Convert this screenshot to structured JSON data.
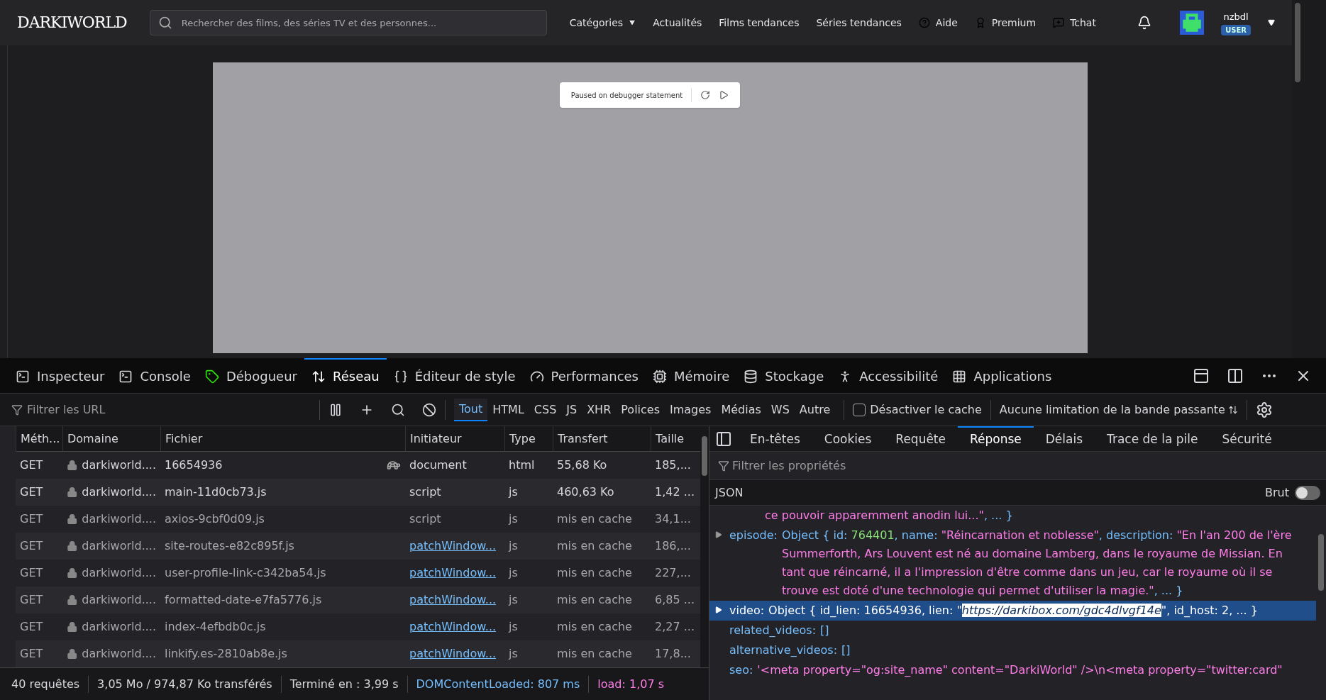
{
  "site": {
    "logo": "DARKIWORLD",
    "search": {
      "placeholder": "Rechercher des films, des séries TV et des personnes..."
    },
    "nav": [
      {
        "label": "Catégories",
        "kind": "dropdown"
      },
      {
        "label": "Actualités",
        "kind": "link"
      },
      {
        "label": "Films tendances",
        "kind": "link"
      },
      {
        "label": "Séries tendances",
        "kind": "link"
      },
      {
        "label": "Aide",
        "kind": "help"
      },
      {
        "label": "Premium",
        "kind": "premium"
      },
      {
        "label": "Tchat",
        "kind": "chat"
      }
    ],
    "user": {
      "name": "nzbdl",
      "badge": "USER"
    },
    "debugger_banner": "Paused on debugger statement"
  },
  "devtools": {
    "tabs": [
      {
        "label": "Inspecteur",
        "selected": false
      },
      {
        "label": "Console",
        "selected": false
      },
      {
        "label": "Débogueur",
        "selected": false
      },
      {
        "label": "Réseau",
        "selected": true
      },
      {
        "label": "Éditeur de style",
        "selected": false
      },
      {
        "label": "Performances",
        "selected": false
      },
      {
        "label": "Mémoire",
        "selected": false
      },
      {
        "label": "Stockage",
        "selected": false
      },
      {
        "label": "Accessibilité",
        "selected": false
      },
      {
        "label": "Applications",
        "selected": false
      }
    ],
    "url_filter": {
      "placeholder": "Filtrer les URL"
    },
    "type_filters": [
      {
        "label": "Tout",
        "selected": true
      },
      {
        "label": "HTML",
        "selected": false
      },
      {
        "label": "CSS",
        "selected": false
      },
      {
        "label": "JS",
        "selected": false
      },
      {
        "label": "XHR",
        "selected": false
      },
      {
        "label": "Polices",
        "selected": false
      },
      {
        "label": "Images",
        "selected": false
      },
      {
        "label": "Médias",
        "selected": false
      },
      {
        "label": "WS",
        "selected": false
      },
      {
        "label": "Autre",
        "selected": false
      }
    ],
    "disable_cache": {
      "label": "Désactiver le cache",
      "checked": false
    },
    "throttling": "Aucune limitation de la bande passante",
    "table": {
      "columns": [
        "Méth...",
        "Domaine",
        "Fichier",
        "Initiateur",
        "Type",
        "Transfert",
        "Taille"
      ],
      "rows": [
        {
          "method": "GET",
          "domain": "darkiworld....",
          "file": "16654936",
          "slow": true,
          "initiator": "document",
          "initiator_link": false,
          "type": "html",
          "transfer": "55,68 Ko",
          "size": "185,...",
          "cached": false
        },
        {
          "method": "GET",
          "domain": "darkiworld....",
          "file": "main-11d0cb73.js",
          "slow": false,
          "initiator": "script",
          "initiator_link": false,
          "type": "js",
          "transfer": "460,63 Ko",
          "size": "1,42 ...",
          "cached": false
        },
        {
          "method": "GET",
          "domain": "darkiworld....",
          "file": "axios-9cbf0d09.js",
          "slow": false,
          "initiator": "script",
          "initiator_link": false,
          "type": "js",
          "transfer": "mis en cache",
          "size": "34,1...",
          "cached": true
        },
        {
          "method": "GET",
          "domain": "darkiworld....",
          "file": "site-routes-e82c895f.js",
          "slow": false,
          "initiator": "patchWindow...",
          "initiator_link": true,
          "type": "js",
          "transfer": "mis en cache",
          "size": "186,...",
          "cached": true
        },
        {
          "method": "GET",
          "domain": "darkiworld....",
          "file": "user-profile-link-c342ba54.js",
          "slow": false,
          "initiator": "patchWindow...",
          "initiator_link": true,
          "type": "js",
          "transfer": "mis en cache",
          "size": "227,...",
          "cached": true
        },
        {
          "method": "GET",
          "domain": "darkiworld....",
          "file": "formatted-date-e7fa5776.js",
          "slow": false,
          "initiator": "patchWindow...",
          "initiator_link": true,
          "type": "js",
          "transfer": "mis en cache",
          "size": "6,85 ...",
          "cached": true
        },
        {
          "method": "GET",
          "domain": "darkiworld....",
          "file": "index-4efbdb0c.js",
          "slow": false,
          "initiator": "patchWindow...",
          "initiator_link": true,
          "type": "js",
          "transfer": "mis en cache",
          "size": "2,27 ...",
          "cached": true
        },
        {
          "method": "GET",
          "domain": "darkiworld....",
          "file": "linkify.es-2810ab8e.js",
          "slow": false,
          "initiator": "patchWindow...",
          "initiator_link": true,
          "type": "js",
          "transfer": "mis en cache",
          "size": "17,8...",
          "cached": true
        }
      ]
    },
    "status_bar": [
      {
        "text": "40 requêtes",
        "color": "#d7d7db"
      },
      {
        "text": "3,05 Mo / 974,87 Ko transférés",
        "color": "#d7d7db"
      },
      {
        "text": "Terminé en : 3,99 s",
        "color": "#d7d7db"
      },
      {
        "text": "DOMContentLoaded: 807 ms",
        "color": "#75bfff"
      },
      {
        "text": "load: 1,07 s",
        "color": "#ff7de9"
      }
    ],
    "detail_tabs": [
      {
        "label": "En-têtes",
        "selected": false
      },
      {
        "label": "Cookies",
        "selected": false
      },
      {
        "label": "Requête",
        "selected": false
      },
      {
        "label": "Réponse",
        "selected": true
      },
      {
        "label": "Délais",
        "selected": false
      },
      {
        "label": "Trace de la pile",
        "selected": false
      },
      {
        "label": "Sécurité",
        "selected": false
      }
    ],
    "property_filter": {
      "placeholder": "Filtrer les propriétés"
    },
    "response": {
      "label": "JSON",
      "raw": {
        "label": "Brut",
        "on": false
      },
      "lines": [
        {
          "expandable": false,
          "selected": false,
          "tokens": [
            {
              "kind": "string",
              "text": "ce pouvoir apparemment anodin lui...\""
            },
            {
              "kind": "plain",
              "text": ", ... }"
            }
          ]
        },
        {
          "key": "episode:",
          "expandable": true,
          "selected": false,
          "tokens": [
            {
              "kind": "plain",
              "text": "Object { id: "
            },
            {
              "kind": "number",
              "text": "764401"
            },
            {
              "kind": "plain",
              "text": ", name: "
            },
            {
              "kind": "string",
              "text": "\"Réincarnation et noblesse\""
            },
            {
              "kind": "plain",
              "text": ", description: "
            },
            {
              "kind": "string",
              "text": "\"En l'an 200 de l'ère Summerforth, Ars Louvent est né au domaine Lamberg, dans le royaume de Missian. En tant que réincarné, il a l'impression d'être comme dans un jeu, car le royaume où il se trouve est doté d'une technologie qui permet d'utiliser la magie.\""
            },
            {
              "kind": "plain",
              "text": ", ... }"
            }
          ]
        },
        {
          "key": "video:",
          "expandable": true,
          "selected": true,
          "tokens": [
            {
              "kind": "plain",
              "text": "Object { id_lien: 16654936, lien: \""
            },
            {
              "kind": "highlight",
              "text": "https://darkibox.com/gdc4dlvgf14e"
            },
            {
              "kind": "plain",
              "text": "\", id_host: 2, ... }"
            }
          ]
        },
        {
          "key": "related_videos:",
          "expandable": false,
          "selected": false,
          "tokens": [
            {
              "kind": "plain",
              "text": "[]"
            }
          ]
        },
        {
          "key": "alternative_videos:",
          "expandable": false,
          "selected": false,
          "tokens": [
            {
              "kind": "plain",
              "text": "[]"
            }
          ]
        },
        {
          "key": "seo:",
          "expandable": false,
          "selected": false,
          "tokens": [
            {
              "kind": "string",
              "text": "'<meta property=\"og:site_name\" content=\"DarkiWorld\" />\\n<meta property=\"twitter:card\""
            }
          ]
        }
      ]
    }
  }
}
